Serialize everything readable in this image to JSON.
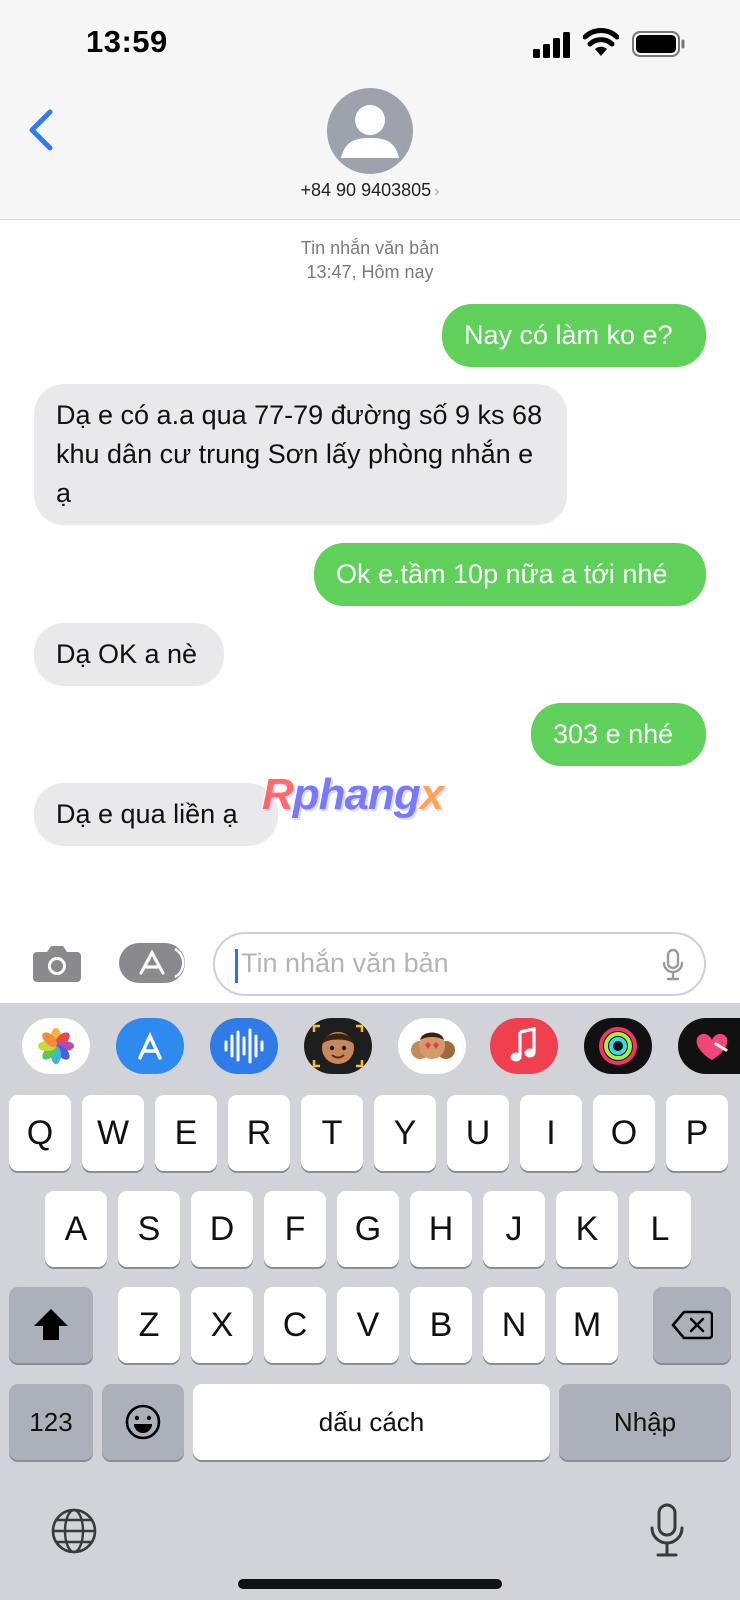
{
  "status_bar": {
    "time": "13:59"
  },
  "header": {
    "contact": "+84 90 9403805",
    "chevron": "›"
  },
  "thread": {
    "meta_type": "Tin nhắn văn bản",
    "meta_time": "13:47, Hôm nay",
    "messages": [
      {
        "dir": "out",
        "text": "Nay có làm ko e?"
      },
      {
        "dir": "in",
        "text": "Dạ e có a.a qua 77-79 đường số 9 ks 68 khu dân cư trung Sơn lấy phòng nhắn e ạ"
      },
      {
        "dir": "out",
        "text": "Ok e.tầm 10p nữa a tới nhé"
      },
      {
        "dir": "in",
        "text": "Dạ OK a nè"
      },
      {
        "dir": "out",
        "text": "303 e nhé"
      },
      {
        "dir": "in",
        "text": "Dạ e qua liền ạ"
      }
    ]
  },
  "watermark": {
    "part1": "R",
    "part2": "phang",
    "part3": "x"
  },
  "compose": {
    "placeholder": "Tin nhắn văn bản"
  },
  "app_strip": [
    "photos-icon",
    "app-store-icon",
    "audio-message-icon",
    "memoji-icon",
    "memoji-stickers-icon",
    "music-icon",
    "activity-icon",
    "digital-touch-icon"
  ],
  "keyboard": {
    "row1": [
      "Q",
      "W",
      "E",
      "R",
      "T",
      "Y",
      "U",
      "I",
      "O",
      "P"
    ],
    "row2": [
      "A",
      "S",
      "D",
      "F",
      "G",
      "H",
      "J",
      "K",
      "L"
    ],
    "row3": [
      "Z",
      "X",
      "C",
      "V",
      "B",
      "N",
      "M"
    ],
    "numbers_key": "123",
    "space_key": "dấu cách",
    "return_key": "Nhập"
  },
  "colors": {
    "outgoing": "#5fd05a",
    "incoming": "#e9e9eb",
    "accent": "#2f7bf0"
  }
}
